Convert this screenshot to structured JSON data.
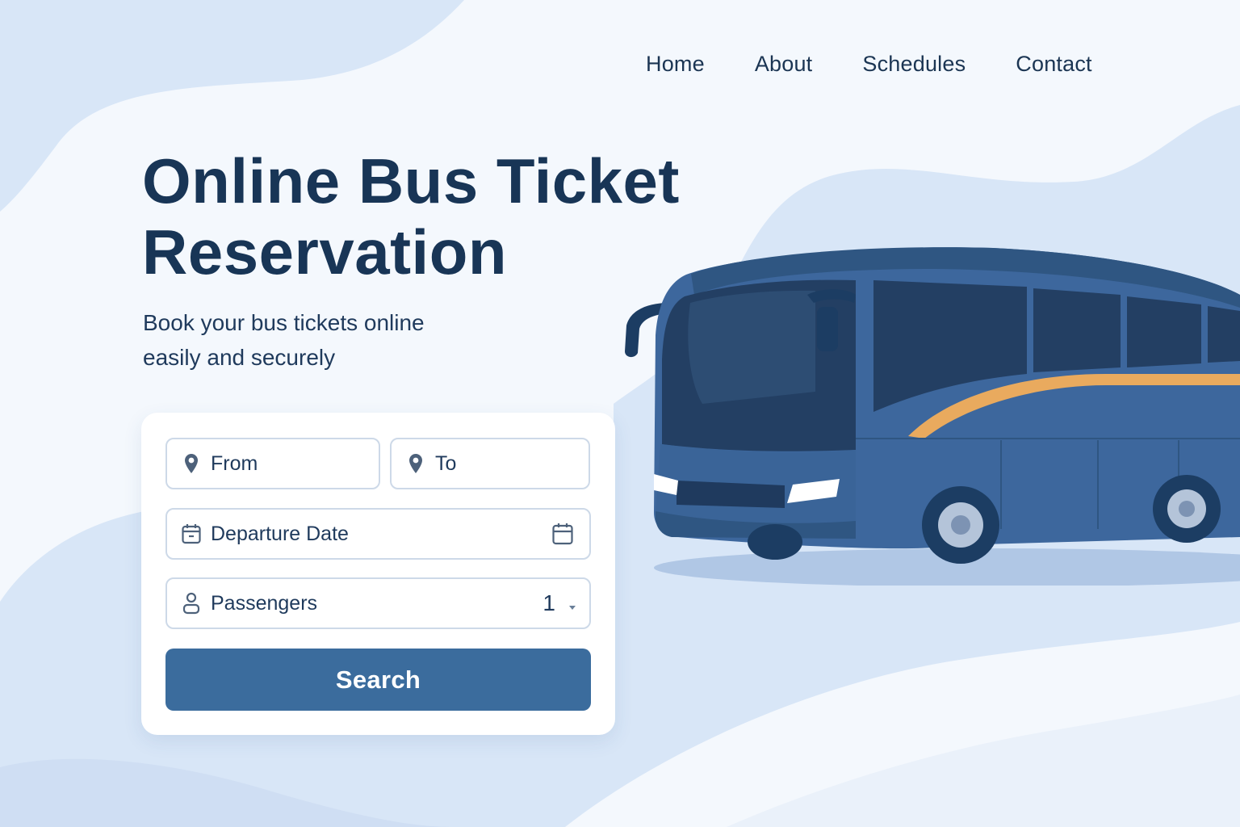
{
  "nav": {
    "items": [
      {
        "label": "Home"
      },
      {
        "label": "About"
      },
      {
        "label": "Schedules"
      },
      {
        "label": "Contact"
      }
    ]
  },
  "hero": {
    "title": "Online Bus Ticket Reservation",
    "subtitle": "Book your bus tickets online easily and securely"
  },
  "search_form": {
    "from_label": "From",
    "to_label": "To",
    "date_label": "Departure Date",
    "passengers_label": "Passengers",
    "passengers_value": "1",
    "search_label": "Search"
  },
  "colors": {
    "background": "#f3f7fc",
    "wave": "#d6e4f6",
    "heading": "#183556",
    "button": "#3b6c9d",
    "bus_body": "#3d679d",
    "bus_stripe": "#e9aa5e"
  },
  "icons": {
    "from": "map-pin-icon",
    "to": "map-pin-icon",
    "date": "calendar-icon",
    "passengers": "person-icon",
    "dropdown": "chevron-down-icon"
  }
}
